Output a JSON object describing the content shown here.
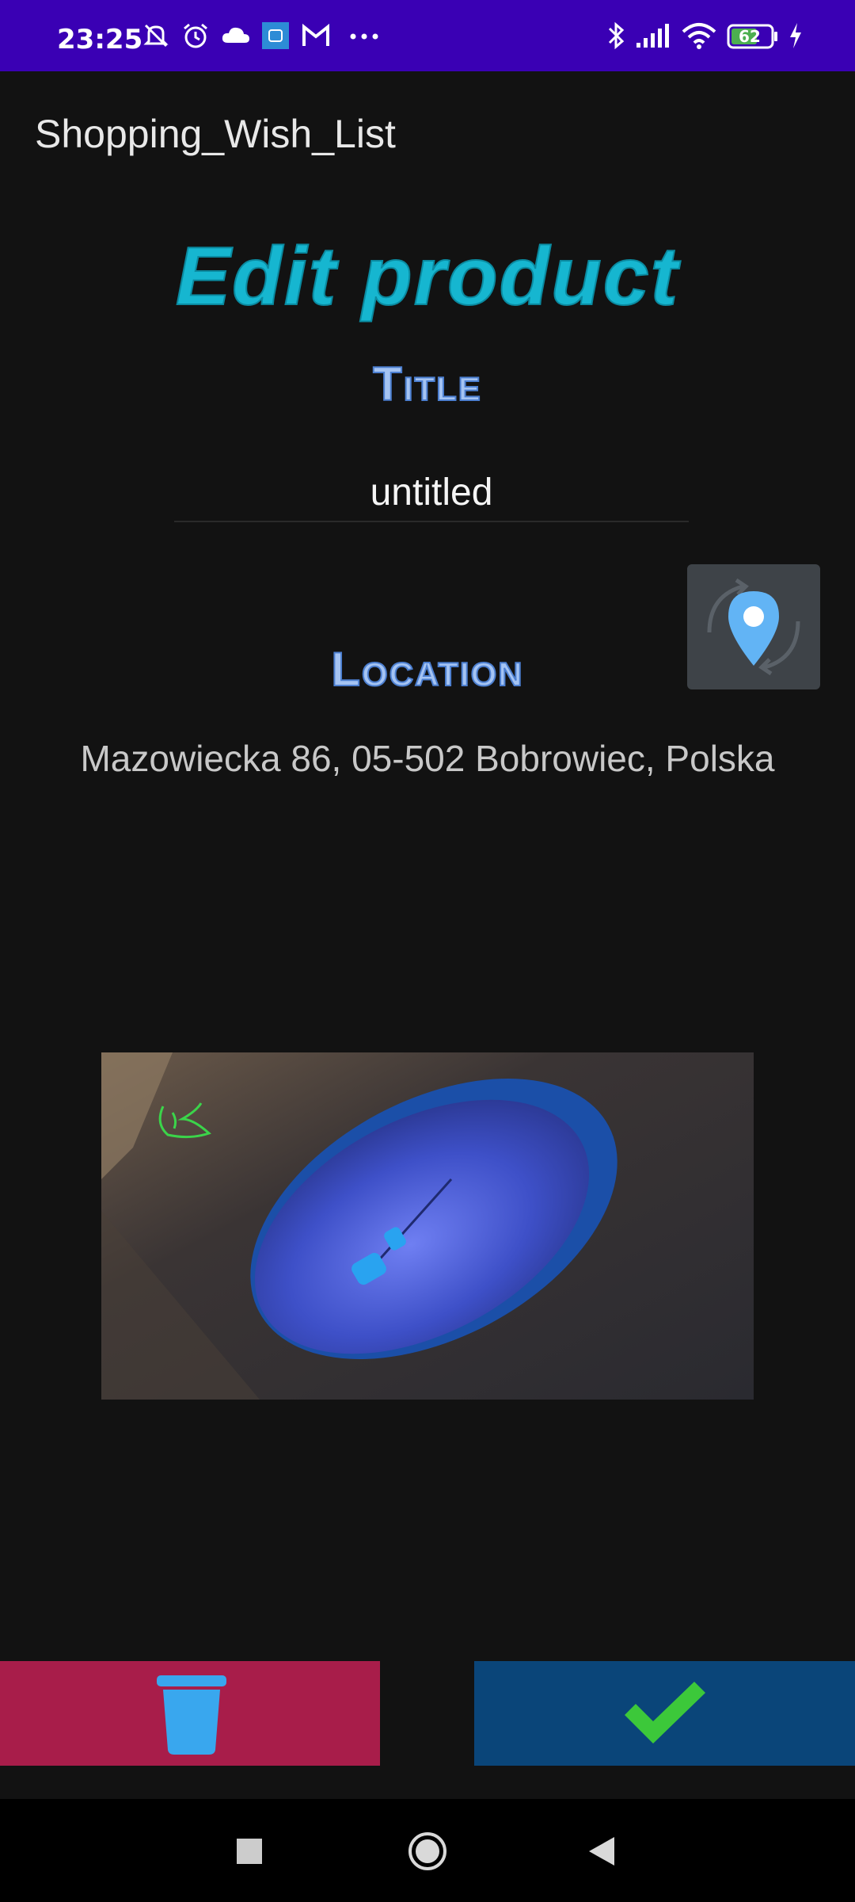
{
  "status_bar": {
    "time": "23:25",
    "battery_level": "62",
    "icons": [
      "mute-icon",
      "alarm-icon",
      "cloud-icon",
      "app-notification-icon",
      "gmail-icon",
      "more-icon",
      "bluetooth-icon",
      "signal-icon",
      "wifi-icon",
      "battery-icon",
      "charging-icon"
    ]
  },
  "app_bar": {
    "title": "Shopping_Wish_List"
  },
  "page": {
    "heading": "Edit product"
  },
  "title_section": {
    "label": "Title",
    "value": "untitled"
  },
  "location_section": {
    "label": "Location",
    "address": "Mazowiecka 86, 05-502 Bobrowiec, Polska",
    "button_icon": "location-pin-icon"
  },
  "image": {
    "description_icon": "product-photo"
  },
  "actions": {
    "delete_icon": "trash-icon",
    "confirm_icon": "checkmark-icon"
  },
  "nav": {
    "icons": [
      "recent-apps-icon",
      "home-icon",
      "back-icon"
    ]
  },
  "colors": {
    "status_bar": "#3a00b4",
    "background": "#121212",
    "heading": "#16b6d0",
    "label": "#a5c4f3",
    "delete": "#a81d4a",
    "confirm": "#0a4579"
  }
}
